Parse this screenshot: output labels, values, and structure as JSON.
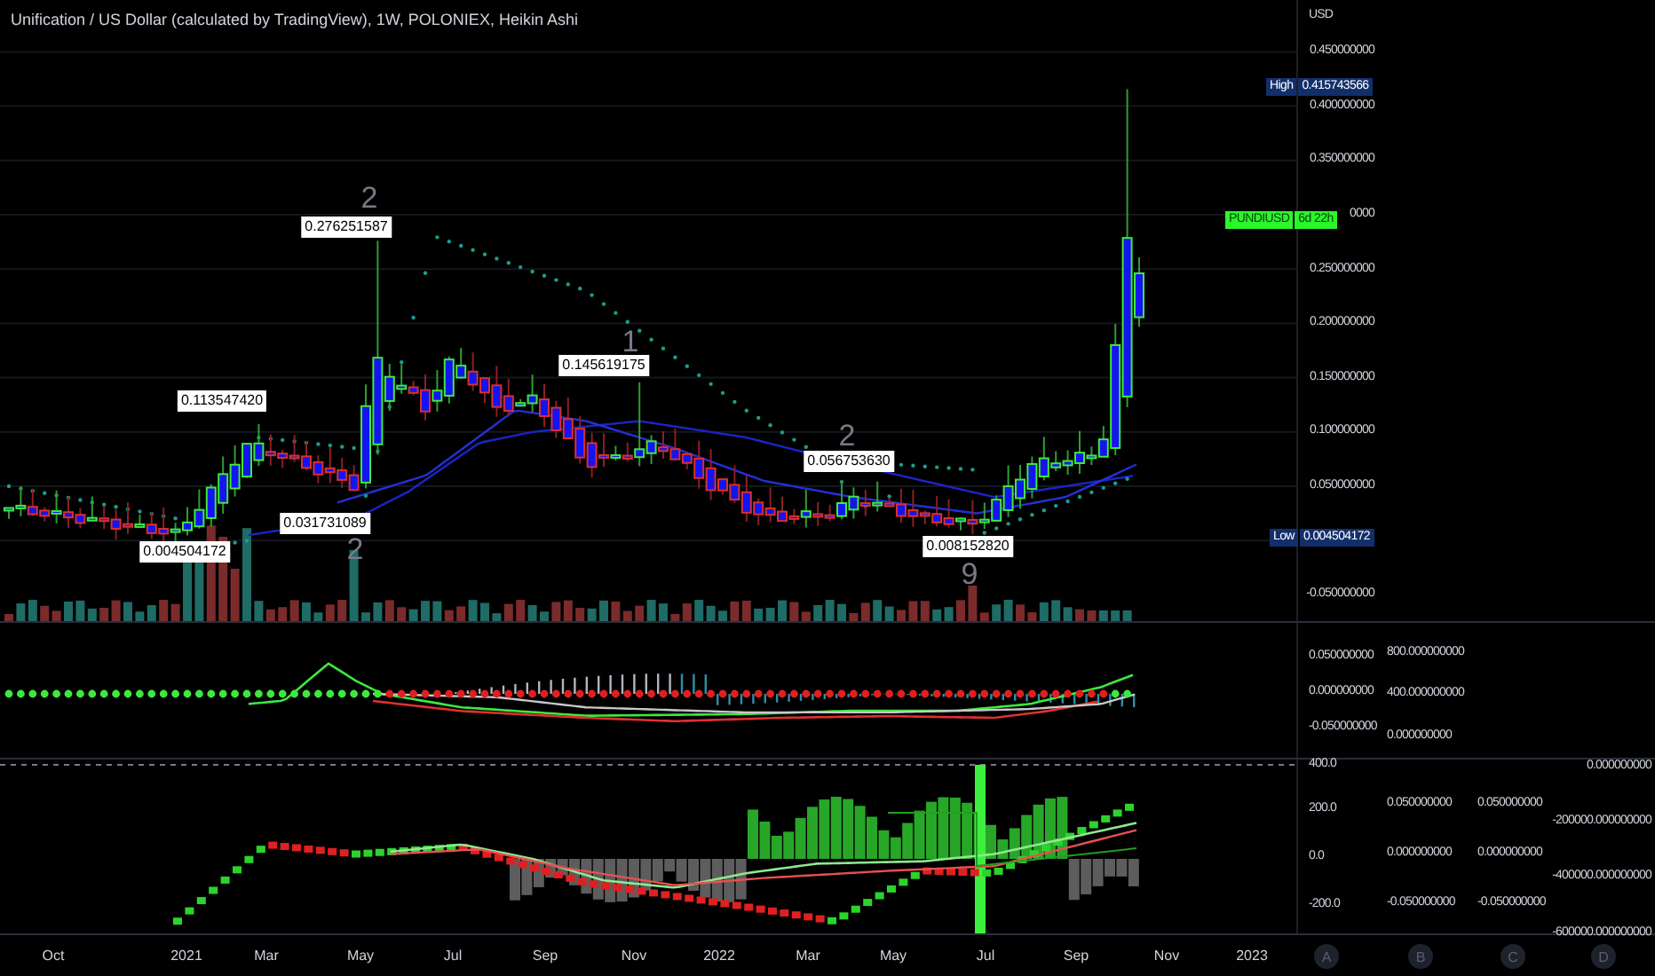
{
  "header": {
    "title": "Unification / US Dollar (calculated by TradingView), 1W, POLONIEX, Heikin Ashi"
  },
  "price_axis": {
    "unit": "USD",
    "ticks": [
      "0.450000000",
      "0.400000000",
      "0.350000000",
      "0000",
      "0.250000000",
      "0.200000000",
      "0.150000000",
      "0.100000000",
      "0.050000000",
      "-0.050000000"
    ]
  },
  "high_badge": {
    "label": "High",
    "value": "0.415743566"
  },
  "symbol_badge": {
    "label": "PUNDIUSD",
    "countdown": "6d 22h"
  },
  "low_badge": {
    "label": "Low",
    "value": "0.004504172"
  },
  "price_callouts": [
    {
      "text": "0.113547420"
    },
    {
      "text": "0.276251587"
    },
    {
      "text": "0.031731089"
    },
    {
      "text": "0.004504172"
    },
    {
      "text": "0.145619175"
    },
    {
      "text": "0.056753630"
    },
    {
      "text": "0.008152820"
    }
  ],
  "wave_labels": [
    {
      "text": "2"
    },
    {
      "text": "2"
    },
    {
      "text": "1"
    },
    {
      "text": "2"
    },
    {
      "text": "9"
    }
  ],
  "oscillator_pane": {
    "axis_a": [
      "0.050000000",
      "0.000000000",
      "-0.050000000"
    ],
    "axis_b": [
      "800.000000000",
      "400.000000000",
      "0.000000000"
    ]
  },
  "lower_pane": {
    "axis_a": [
      "400.0",
      "200.0",
      "0.0",
      "-200.0"
    ],
    "axis_b": [
      "0.050000000",
      "0.000000000",
      "-0.050000000"
    ],
    "axis_c": [
      "0.050000000",
      "0.000000000",
      "-0.050000000"
    ],
    "axis_d": [
      "0.000000000",
      "-200000.000000000",
      "-400000.000000000",
      "-600000.000000000"
    ]
  },
  "time_axis": {
    "labels": [
      "Oct",
      "2021",
      "Mar",
      "May",
      "Jul",
      "Sep",
      "Nov",
      "2022",
      "Mar",
      "May",
      "Jul",
      "Sep",
      "Nov",
      "2023"
    ]
  },
  "scale_buttons": [
    "A",
    "B",
    "C",
    "D"
  ]
}
